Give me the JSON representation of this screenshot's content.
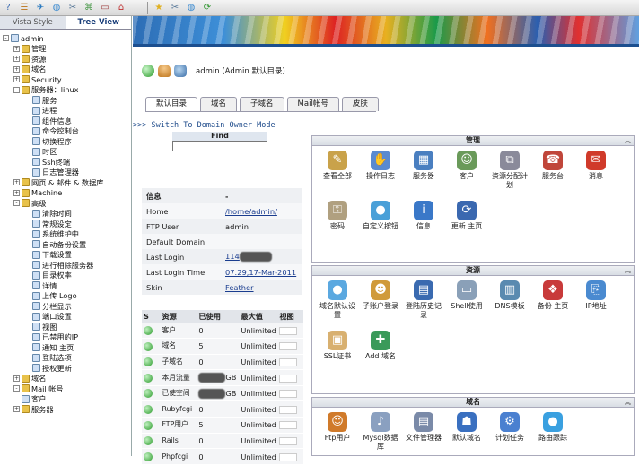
{
  "toolbar": {
    "left_icons": [
      "help-icon",
      "bookmark-icon",
      "bird-icon",
      "globe-icon",
      "tools-icon",
      "net-icon",
      "card-icon",
      "home-icon"
    ],
    "right_icons": [
      "star-icon",
      "tools-icon",
      "globe-icon",
      "refresh-icon"
    ]
  },
  "sidebar": {
    "tabs": [
      "Vista Style",
      "Tree View"
    ],
    "nodes": [
      {
        "label": "admin",
        "indent": 0,
        "pm": "-",
        "icon": "user"
      },
      {
        "label": "管理",
        "indent": 1,
        "pm": "+",
        "icon": "fold"
      },
      {
        "label": "资源",
        "indent": 1,
        "pm": "+",
        "icon": "fold"
      },
      {
        "label": "域名",
        "indent": 1,
        "pm": "+",
        "icon": "fold"
      },
      {
        "label": "Security",
        "indent": 1,
        "pm": "+",
        "icon": "fold"
      },
      {
        "label": "服务器：linux",
        "indent": 1,
        "pm": "-",
        "icon": "fold"
      },
      {
        "label": "服务",
        "indent": 2,
        "pm": "",
        "icon": "page"
      },
      {
        "label": "进程",
        "indent": 2,
        "pm": "",
        "icon": "page"
      },
      {
        "label": "组件信息",
        "indent": 2,
        "pm": "",
        "icon": "page"
      },
      {
        "label": "命令控制台",
        "indent": 2,
        "pm": "",
        "icon": "page"
      },
      {
        "label": "切换程序",
        "indent": 2,
        "pm": "",
        "icon": "page"
      },
      {
        "label": "时区",
        "indent": 2,
        "pm": "",
        "icon": "page"
      },
      {
        "label": "Ssh终端",
        "indent": 2,
        "pm": "",
        "icon": "page"
      },
      {
        "label": "日志管理器",
        "indent": 2,
        "pm": "",
        "icon": "page"
      },
      {
        "label": "网页 & 邮件 & 数据库",
        "indent": 1,
        "pm": "+",
        "icon": "fold"
      },
      {
        "label": "Machine",
        "indent": 1,
        "pm": "+",
        "icon": "fold"
      },
      {
        "label": "高级",
        "indent": 1,
        "pm": "-",
        "icon": "fold"
      },
      {
        "label": "清除时间",
        "indent": 2,
        "pm": "",
        "icon": "page"
      },
      {
        "label": "常规设定",
        "indent": 2,
        "pm": "",
        "icon": "page"
      },
      {
        "label": "系统维护中",
        "indent": 2,
        "pm": "",
        "icon": "page"
      },
      {
        "label": "自动备份设置",
        "indent": 2,
        "pm": "",
        "icon": "page"
      },
      {
        "label": "下载设置",
        "indent": 2,
        "pm": "",
        "icon": "page"
      },
      {
        "label": "进行相除服务器",
        "indent": 2,
        "pm": "",
        "icon": "page"
      },
      {
        "label": "目录权率",
        "indent": 2,
        "pm": "",
        "icon": "page"
      },
      {
        "label": "详情",
        "indent": 2,
        "pm": "",
        "icon": "page"
      },
      {
        "label": "上传 Logo",
        "indent": 2,
        "pm": "",
        "icon": "page"
      },
      {
        "label": "分栏显示",
        "indent": 2,
        "pm": "",
        "icon": "page"
      },
      {
        "label": "端口设置",
        "indent": 2,
        "pm": "",
        "icon": "page"
      },
      {
        "label": "视图",
        "indent": 2,
        "pm": "",
        "icon": "page"
      },
      {
        "label": "已禁用的IP",
        "indent": 2,
        "pm": "",
        "icon": "page"
      },
      {
        "label": "通知 主页",
        "indent": 2,
        "pm": "",
        "icon": "page"
      },
      {
        "label": "登陆选项",
        "indent": 2,
        "pm": "",
        "icon": "page"
      },
      {
        "label": "授权更新",
        "indent": 2,
        "pm": "",
        "icon": "page"
      },
      {
        "label": "域名",
        "indent": 1,
        "pm": "+",
        "icon": "fold"
      },
      {
        "label": "Mail 帐号",
        "indent": 1,
        "pm": "-",
        "icon": "fold"
      },
      {
        "label": "客户",
        "indent": 1,
        "pm": "",
        "icon": "page"
      },
      {
        "label": "服务器",
        "indent": 1,
        "pm": "+",
        "icon": "fold"
      }
    ]
  },
  "header": {
    "title": "admin (Admin 默认目录)"
  },
  "tabs": [
    "默认目录",
    "域名",
    "子域名",
    "Mail帐号",
    "皮肤"
  ],
  "switch_link": ">>> Switch To Domain Owner Mode",
  "find": {
    "label": "Find",
    "value": ""
  },
  "info": {
    "header": [
      "信息",
      "-"
    ],
    "rows": [
      {
        "k": "Home",
        "v": "/home/admin/",
        "link": true
      },
      {
        "k": "FTP User",
        "v": "admin",
        "link": false
      },
      {
        "k": "Default Domain",
        "v": "",
        "link": false
      },
      {
        "k": "Last Login",
        "v": "114",
        "link": true,
        "redacted": true
      },
      {
        "k": "Last Login Time",
        "v": "07.29,17-Mar-2011",
        "link": true
      },
      {
        "k": "Skin",
        "v": "Feather",
        "link": true
      }
    ]
  },
  "resources": {
    "header": [
      "S",
      "资源",
      "已使用",
      "最大值",
      "视图"
    ],
    "rows": [
      {
        "name": "客户",
        "used": "0",
        "max": "Unlimited"
      },
      {
        "name": "域名",
        "used": "5",
        "max": "Unlimited"
      },
      {
        "name": "子域名",
        "used": "0",
        "max": "Unlimited"
      },
      {
        "name": "本月流量",
        "used": "GB",
        "max": "Unlimited",
        "redacted": true
      },
      {
        "name": "已使空间",
        "used": "GB",
        "max": "Unlimited",
        "redacted": true
      },
      {
        "name": "Rubyfcgi",
        "used": "0",
        "max": "Unlimited"
      },
      {
        "name": "FTP用户",
        "used": "5",
        "max": "Unlimited"
      },
      {
        "name": "Rails",
        "used": "0",
        "max": "Unlimited"
      },
      {
        "name": "Phpfcgi",
        "used": "0",
        "max": "Unlimited"
      }
    ]
  },
  "panels": [
    {
      "title": "管理",
      "items": [
        {
          "label": "查看全部",
          "icon": "doc-icon",
          "color": "#c9a24a",
          "glyph": "✎"
        },
        {
          "label": "操作日志",
          "icon": "log-icon",
          "color": "#5a8ad0",
          "glyph": "✋"
        },
        {
          "label": "服务器",
          "icon": "server-icon",
          "color": "#4a7fc0",
          "glyph": "▦"
        },
        {
          "label": "客户",
          "icon": "client-icon",
          "color": "#6a9a5a",
          "glyph": "☺"
        },
        {
          "label": "资源分配计划",
          "icon": "plan-icon",
          "color": "#8a8a9a",
          "glyph": "⧉"
        },
        {
          "label": "服务台",
          "icon": "helpdesk-icon",
          "color": "#c0463a",
          "glyph": "☎"
        },
        {
          "label": "消息",
          "icon": "message-icon",
          "color": "#d03a2a",
          "glyph": "✉"
        },
        {
          "label": "密码",
          "icon": "key-icon",
          "color": "#b0a080",
          "glyph": "⚿"
        },
        {
          "label": "自定义按钮",
          "icon": "custom-button-icon",
          "color": "#4aa0d8",
          "glyph": "●"
        },
        {
          "label": "信息",
          "icon": "info-icon",
          "color": "#3a78c8",
          "glyph": "i"
        },
        {
          "label": "更新 主页",
          "icon": "update-icon",
          "color": "#3a68b0",
          "glyph": "⟳"
        }
      ]
    },
    {
      "title": "资源",
      "items": [
        {
          "label": "域名默认设置",
          "icon": "domain-settings-icon",
          "color": "#5aa8e0",
          "glyph": "●"
        },
        {
          "label": "子账户登录",
          "icon": "subaccount-icon",
          "color": "#d09a3a",
          "glyph": "☻"
        },
        {
          "label": "登陆历史记录",
          "icon": "history-icon",
          "color": "#3a6ab0",
          "glyph": "▤"
        },
        {
          "label": "Shell使用",
          "icon": "shell-icon",
          "color": "#8aa0b8",
          "glyph": "▭"
        },
        {
          "label": "DNS模板",
          "icon": "dns-icon",
          "color": "#5a8ab0",
          "glyph": "▥"
        },
        {
          "label": "备份 主页",
          "icon": "backup-icon",
          "color": "#c83a3a",
          "glyph": "❖"
        },
        {
          "label": "IP地址",
          "icon": "ip-icon",
          "color": "#4a8ad0",
          "glyph": "⎘"
        },
        {
          "label": "SSL证书",
          "icon": "ssl-icon",
          "color": "#d8b070",
          "glyph": "▣"
        },
        {
          "label": "Add 域名",
          "icon": "add-domain-icon",
          "color": "#3a9a5a",
          "glyph": "✚"
        }
      ]
    },
    {
      "title": "域名",
      "items": [
        {
          "label": "Ftp用户",
          "icon": "ftp-user-icon",
          "color": "#d07a2a",
          "glyph": "☺"
        },
        {
          "label": "Mysql数据库",
          "icon": "mysql-icon",
          "color": "#8aa0c0",
          "glyph": "♪"
        },
        {
          "label": "文件管理器",
          "icon": "file-manager-icon",
          "color": "#7a8aa8",
          "glyph": "▤"
        },
        {
          "label": "默认域名",
          "icon": "default-domain-icon",
          "color": "#3a70c0",
          "glyph": "☗"
        },
        {
          "label": "计划任务",
          "icon": "cron-icon",
          "color": "#4a80d0",
          "glyph": "⚙"
        },
        {
          "label": "路由跟踪",
          "icon": "traceroute-icon",
          "color": "#3aa0e0",
          "glyph": "●"
        }
      ]
    }
  ]
}
